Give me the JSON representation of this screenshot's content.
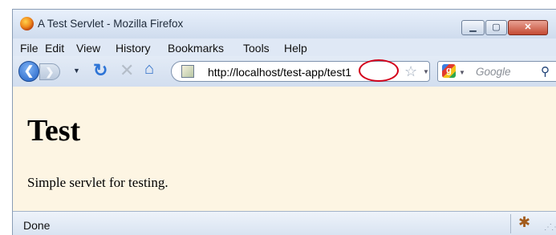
{
  "window": {
    "title": "A Test Servlet - Mozilla Firefox",
    "buttons": {
      "minimize": "▁",
      "maximize": "▢",
      "close": "✕"
    }
  },
  "menubar": {
    "items": [
      "File",
      "Edit",
      "View",
      "History",
      "Bookmarks",
      "Tools",
      "Help"
    ]
  },
  "navigation": {
    "url": "http://localhost/test-app/test1",
    "search_placeholder": "Google",
    "icons": [
      "back-icon",
      "forward-icon",
      "history-dropdown-icon",
      "reload-icon",
      "stop-icon",
      "home-icon",
      "bookmark-star-icon",
      "google-icon",
      "search-icon"
    ]
  },
  "page": {
    "heading": "Test",
    "paragraph": "Simple servlet for testing."
  },
  "statusbar": {
    "text": "Done"
  },
  "colors": {
    "content_background": "#fdf5e3",
    "highlight_circle": "#d3001a",
    "chrome": "#dbe6f4"
  }
}
